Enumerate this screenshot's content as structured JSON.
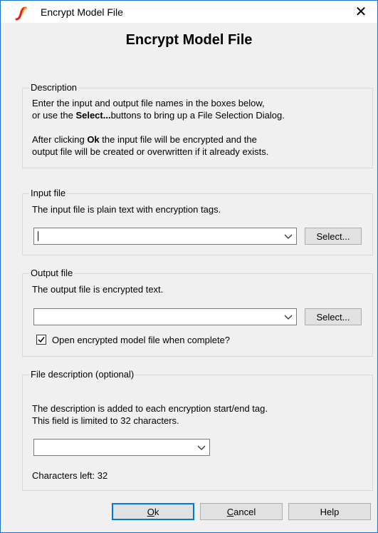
{
  "window": {
    "title": "Encrypt Model File",
    "close_glyph": "✕",
    "app_icon": "spice-s-icon",
    "accent_color": "#1a73c9"
  },
  "heading": "Encrypt Model File",
  "description": {
    "legend": "Description",
    "line1": "Enter the input and output file names in the boxes below,",
    "line2_prefix": "or use the ",
    "line2_bold": "Select...",
    "line2_suffix": "buttons to bring up a File Selection Dialog.",
    "line3_prefix": "After clicking ",
    "line3_bold": "Ok",
    "line3_suffix": " the input file will be encrypted and the",
    "line4": "output file will be created or overwritten if it already exists."
  },
  "input_file": {
    "legend": "Input file",
    "text": "The input file is plain text with encryption tags.",
    "value": "",
    "select_label": "Select..."
  },
  "output_file": {
    "legend": "Output file",
    "text": "The output file is encrypted text.",
    "value": "",
    "select_label": "Select...",
    "checkbox_label": "Open encrypted model file when complete?",
    "checkbox_checked": true
  },
  "file_description": {
    "legend": "File description (optional)",
    "line1": "The description is added to each encryption start/end tag.",
    "line2": "This field is limited to 32 characters.",
    "value": "",
    "chars_left": "Characters left: 32"
  },
  "buttons": {
    "ok_prefix": "",
    "ok_underlined": "O",
    "ok_suffix": "k",
    "cancel_underlined": "C",
    "cancel_suffix": "ancel",
    "help": "Help"
  }
}
